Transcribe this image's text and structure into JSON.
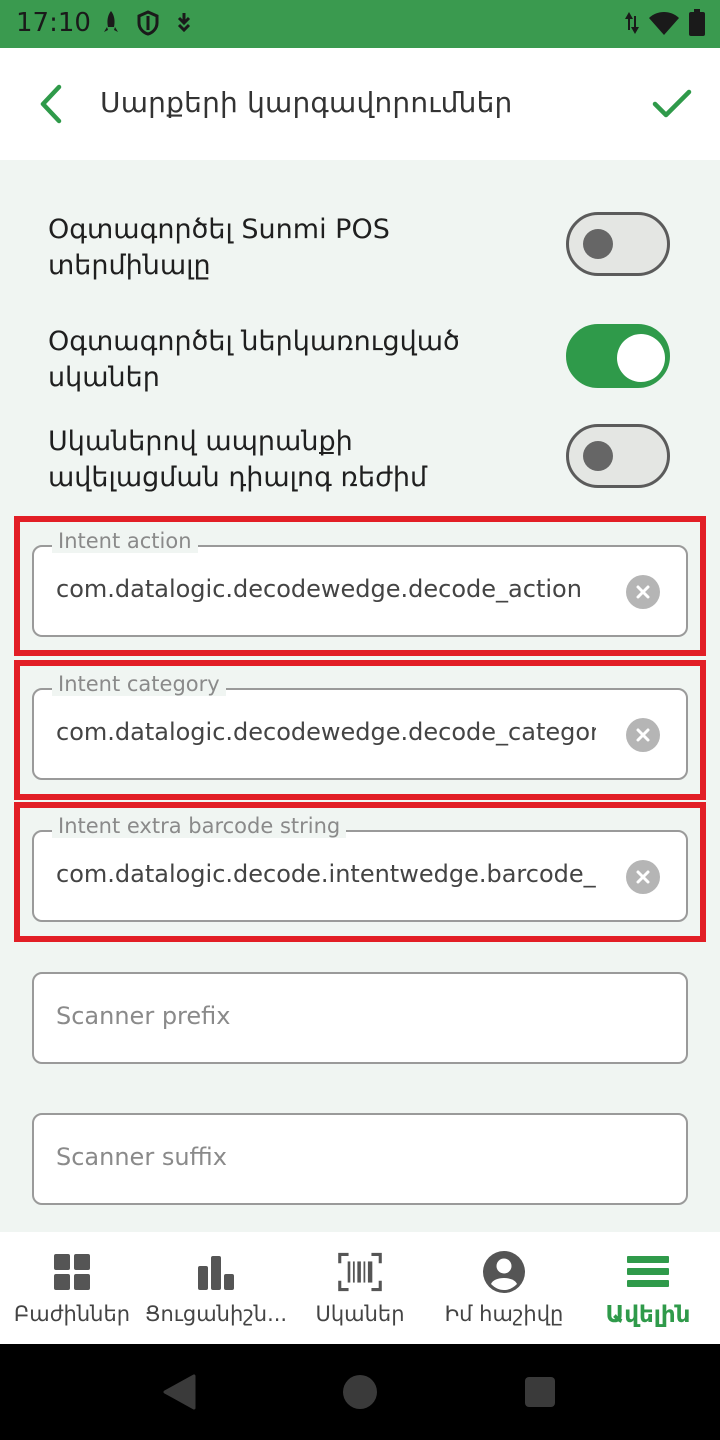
{
  "status_bar": {
    "time": "17:10"
  },
  "header": {
    "title": "Սարքերի կարգավորումներ"
  },
  "toggles": [
    {
      "label_line1": "Օգտագործել Sunmi POS",
      "label_line2": "տերմինալը",
      "on": false
    },
    {
      "label_line1": "Օգտագործել ներկառուցված",
      "label_line2": "սկաներ",
      "on": true
    },
    {
      "label_line1": "Սկաներով ապրանքի",
      "label_line2": "ավելացման դիալոգ ռեժիմ",
      "on": false
    }
  ],
  "fields": [
    {
      "label": "Intent action",
      "value": "com.datalogic.decodewedge.decode_action"
    },
    {
      "label": "Intent category",
      "value": "com.datalogic.decodewedge.decode_category"
    },
    {
      "label": "Intent extra barcode string",
      "value": "com.datalogic.decode.intentwedge.barcode_string"
    }
  ],
  "empty_fields": [
    {
      "placeholder": "Scanner prefix"
    },
    {
      "placeholder": "Scanner suffix"
    }
  ],
  "bottom_nav": [
    {
      "label": "Բաժիններ",
      "icon": "grid-icon"
    },
    {
      "label": "Ցուցանիշն...",
      "icon": "bar-chart-icon"
    },
    {
      "label": "Սկաներ",
      "icon": "barcode-scanner-icon"
    },
    {
      "label": "Իմ հաշիվը",
      "icon": "account-icon"
    },
    {
      "label": "Ավելին",
      "icon": "menu-icon",
      "active": true
    }
  ],
  "colors": {
    "accent": "#2f9a4a",
    "status_bar": "#3a9a4f",
    "highlight": "#e21e26"
  }
}
